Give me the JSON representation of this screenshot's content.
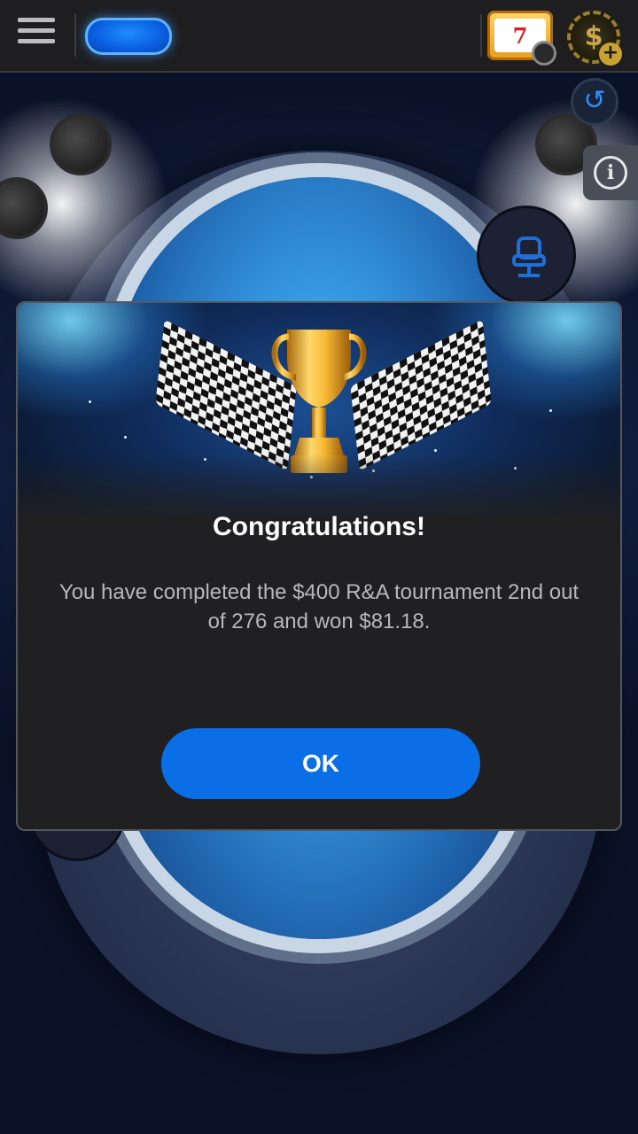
{
  "header": {
    "menu_icon": "hamburger-menu-icon",
    "balance_pill_icon": "blue-pill-button",
    "slots_icon": "slot-machine-icon",
    "slots_text": "7",
    "cashier_icon": "dollar-chip-icon",
    "cashier_symbol": "$",
    "cashier_plus": "+"
  },
  "table": {
    "history_icon": "history-icon",
    "info_icon": "info-icon",
    "info_symbol": "i",
    "seat_icon": "seat-chair-icon"
  },
  "dialog": {
    "trophy_icon": "trophy-icon",
    "flags_icon": "checkered-flag-icon",
    "title": "Congratulations!",
    "message": "You have completed the $400 R&A tournament 2nd out of 276 and won $81.18.",
    "ok_label": "OK"
  },
  "colors": {
    "accent_blue": "#0a6ee6",
    "dialog_bg": "#202022",
    "topbar_bg": "#1e1e20",
    "message_text": "#b7b8bc"
  }
}
